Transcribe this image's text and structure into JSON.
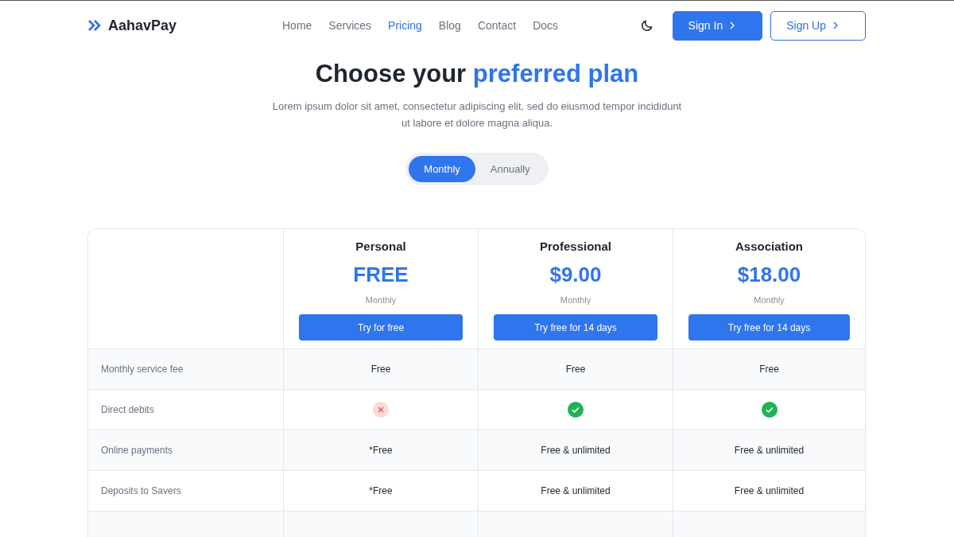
{
  "brand": {
    "name": "AahavPay"
  },
  "nav": [
    {
      "label": "Home",
      "selected": false
    },
    {
      "label": "Services",
      "selected": false
    },
    {
      "label": "Pricing",
      "selected": true
    },
    {
      "label": "Blog",
      "selected": false
    },
    {
      "label": "Contact",
      "selected": false
    },
    {
      "label": "Docs",
      "selected": false
    }
  ],
  "actions": [
    {
      "label": "Sign In",
      "kind": "primary"
    },
    {
      "label": "Sign Up",
      "kind": "outline"
    }
  ],
  "hero": {
    "title_lead": "Choose your",
    "title_highlight": "preferred plan",
    "subtitle": "Lorem ipsum dolor sit amet, consectetur adipiscing elit, sed do eiusmod tempor incididunt ut labore et dolore magna aliqua."
  },
  "billing_toggle": [
    {
      "label": "Monthly",
      "selected": true
    },
    {
      "label": "Annually",
      "selected": false
    }
  ],
  "plans": [
    {
      "name": "Personal",
      "price": "FREE",
      "period": "Monthly",
      "cta": "Try for free"
    },
    {
      "name": "Professional",
      "price": "$9.00",
      "period": "Monthly",
      "cta": "Try free for 14 days"
    },
    {
      "name": "Association",
      "price": "$18.00",
      "period": "Monthly",
      "cta": "Try free for 14 days"
    }
  ],
  "features": [
    {
      "label": "Monthly service fee",
      "cells": [
        {
          "kind": "text",
          "text": "Free"
        },
        {
          "kind": "text",
          "text": "Free"
        },
        {
          "kind": "text",
          "text": "Free"
        }
      ]
    },
    {
      "label": "Direct debits",
      "cells": [
        {
          "kind": "cross"
        },
        {
          "kind": "check"
        },
        {
          "kind": "check"
        }
      ]
    },
    {
      "label": "Online payments",
      "cells": [
        {
          "kind": "text",
          "text": "*Free"
        },
        {
          "kind": "text",
          "text": "Free & unlimited"
        },
        {
          "kind": "text",
          "text": "Free & unlimited"
        }
      ]
    },
    {
      "label": "Deposits to Savers",
      "cells": [
        {
          "kind": "text",
          "text": "*Free"
        },
        {
          "kind": "text",
          "text": "Free & unlimited"
        },
        {
          "kind": "text",
          "text": "Free & unlimited"
        }
      ]
    }
  ]
}
